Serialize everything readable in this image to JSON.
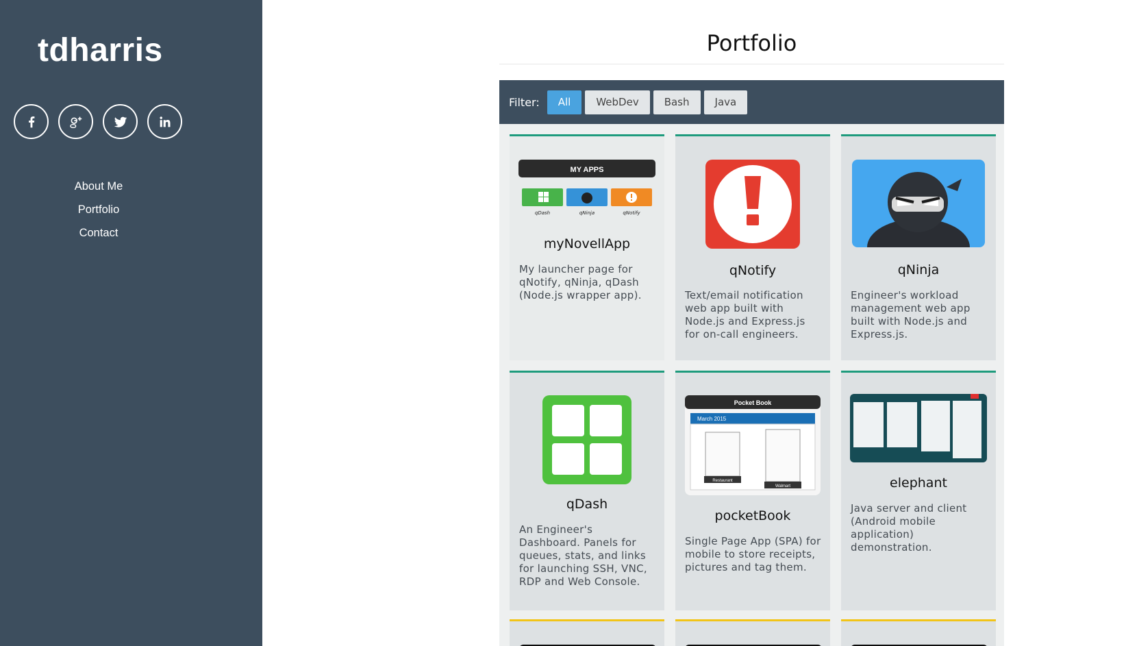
{
  "sidebar": {
    "brand": "tdharris",
    "social_icons": [
      "facebook-icon",
      "google-plus-icon",
      "twitter-icon",
      "linkedin-icon"
    ],
    "nav": [
      "About Me",
      "Portfolio",
      "Contact"
    ]
  },
  "main": {
    "title": "Portfolio",
    "filter": {
      "label": "Filter:",
      "options": [
        "All",
        "WebDev",
        "Bash",
        "Java"
      ],
      "active": "All"
    },
    "cards": [
      {
        "name": "myNovellApp",
        "desc": "My launcher page for qNotify, qNinja, qDash (Node.js wrapper app).",
        "image": "my-apps-screenshot",
        "thumb_text": {
          "header": "MY APPS",
          "labels": [
            "qDash",
            "qNinja",
            "qNotify"
          ]
        }
      },
      {
        "name": "qNotify",
        "desc": "Text/email notification web app built with Node.js and Express.js for on-call engineers.",
        "image": "exclamation-icon"
      },
      {
        "name": "qNinja",
        "desc": "Engineer's workload management web app built with Node.js and Express.js.",
        "image": "ninja-icon"
      },
      {
        "name": "qDash",
        "desc": "An Engineer's Dashboard. Panels for queues, stats, and links for launching SSH, VNC, RDP and Web Console.",
        "image": "dashboard-grid-icon"
      },
      {
        "name": "pocketBook",
        "desc": "Single Page App (SPA) for mobile to store receipts, pictures and tag them.",
        "image": "pocketbook-screenshot",
        "thumb_text": {
          "header": "Pocket Book",
          "month": "March 2015",
          "tags": [
            "Restaurant",
            "Walmart"
          ]
        }
      },
      {
        "name": "elephant",
        "desc": "Java server and client (Android mobile application) demonstration.",
        "image": "elephant-screenshot"
      }
    ],
    "accent_colors": {
      "sidebar": "#3d4e5e",
      "active_filter": "#4aa3df",
      "card_border_green": "#1e9b7d",
      "card_border_yellow": "#f2c417"
    }
  }
}
